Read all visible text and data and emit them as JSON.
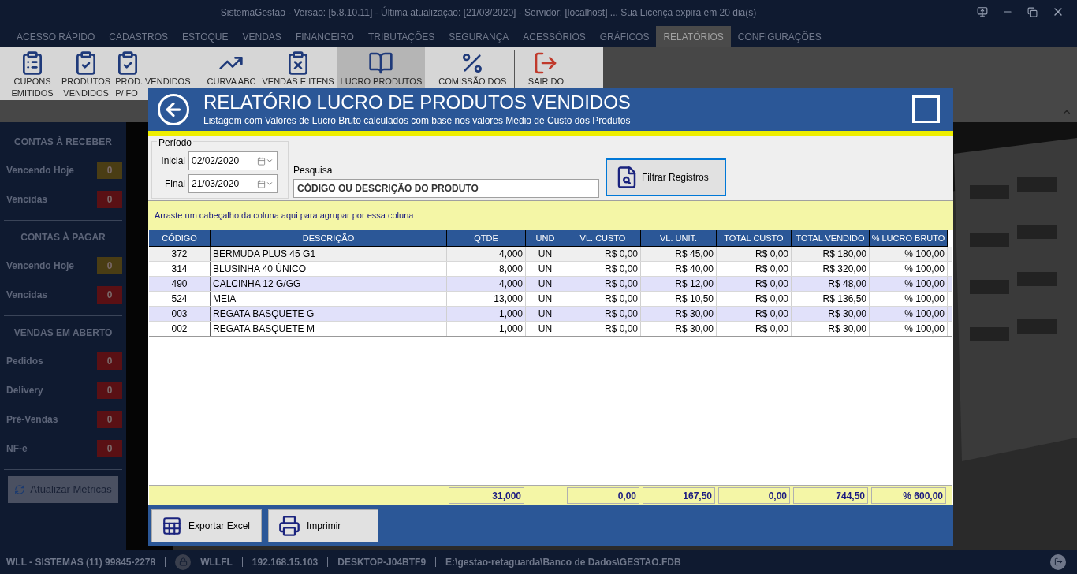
{
  "window": {
    "title": "SistemaGestao - Versão: [5.8.10.11] - Última atualização: [21/03/2020] - Servidor: [localhost] ... Sua Licença expira em 20 dia(s)"
  },
  "tabs": [
    {
      "label": "ACESSO RÁPIDO",
      "selected": false
    },
    {
      "label": "CADASTROS",
      "selected": false
    },
    {
      "label": "ESTOQUE",
      "selected": false
    },
    {
      "label": "VENDAS",
      "selected": false
    },
    {
      "label": "FINANCEIRO",
      "selected": false
    },
    {
      "label": "TRIBUTAÇÕES",
      "selected": false
    },
    {
      "label": "SEGURANÇA",
      "selected": false
    },
    {
      "label": "ACESSÓRIOS",
      "selected": false
    },
    {
      "label": "GRÁFICOS",
      "selected": false
    },
    {
      "label": "RELATÓRIOS",
      "selected": true
    },
    {
      "label": "CONFIGURAÇÕES",
      "selected": false
    }
  ],
  "ribbon": [
    {
      "kind": "coupons",
      "lines": [
        "CUPONS",
        "EMITIDOS"
      ],
      "selected": false
    },
    {
      "kind": "products",
      "lines": [
        "PRODUTOS",
        "VENDIDOS"
      ],
      "selected": false
    },
    {
      "kind": "products",
      "lines": [
        "PROD. VENDIDOS",
        "P/ FO"
      ],
      "selected": false
    },
    {
      "kind": "chart",
      "lines": [
        "CURVA ABC"
      ],
      "selected": false
    },
    {
      "kind": "list",
      "lines": [
        "VENDAS E ITENS"
      ],
      "selected": false
    },
    {
      "kind": "book",
      "lines": [
        "LUCRO PRODUTOS"
      ],
      "selected": true
    },
    {
      "kind": "percent",
      "lines": [
        "COMISSÃO DOS"
      ],
      "selected": false
    },
    {
      "kind": "exit",
      "lines": [
        "SAIR DO"
      ],
      "selected": false
    }
  ],
  "sidebar": {
    "sections": [
      {
        "title": "CONTAS À RECEBER",
        "items": [
          {
            "label": "Vencendo Hoje",
            "count": "0",
            "color": "#4a3d14"
          },
          {
            "label": "Vencidas",
            "count": "0",
            "color": "#5a1014"
          }
        ]
      },
      {
        "title": "CONTAS À PAGAR",
        "items": [
          {
            "label": "Vencendo Hoje",
            "count": "0",
            "color": "#4a3d14"
          },
          {
            "label": "Vencidas",
            "count": "0",
            "color": "#5a1014"
          }
        ]
      },
      {
        "title": "VENDAS EM ABERTO",
        "items": [
          {
            "label": "Pedidos",
            "count": "0",
            "color": "#5a1014"
          },
          {
            "label": "Delivery",
            "count": "0",
            "color": "#5a1014"
          },
          {
            "label": "Pré-Vendas",
            "count": "0",
            "color": "#5a1014"
          },
          {
            "label": "NF-e",
            "count": "0",
            "color": "#5a1014"
          }
        ]
      }
    ],
    "button": "Atualizar Métricas"
  },
  "dialog": {
    "title": "RELATÓRIO LUCRO DE PRODUTOS VENDIDOS",
    "subtitle": "Listagem com Valores de Lucro Bruto calculados com base nos valores Médio de Custo dos Produtos",
    "period": {
      "legend": "Período",
      "start_label": "Inicial",
      "start": "02/02/2020",
      "end_label": "Final",
      "end": "21/03/2020"
    },
    "search": {
      "label": "Pesquisa",
      "value": "CÓDIGO OU DESCRIÇÃO DO PRODUTO"
    },
    "filter_button": "Filtrar Registros",
    "group_hint": "Arraste um cabeçalho da coluna aqui para agrupar por essa coluna",
    "table": {
      "columns": [
        {
          "label": "CÓDIGO"
        },
        {
          "label": "DESCRIÇÃO"
        },
        {
          "label": "QTDE"
        },
        {
          "label": "UND"
        },
        {
          "label": "VL. CUSTO"
        },
        {
          "label": "VL. UNIT."
        },
        {
          "label": "TOTAL CUSTO"
        },
        {
          "label": "TOTAL VENDIDO"
        },
        {
          "label": "% LUCRO BRUTO"
        }
      ],
      "rows": [
        {
          "selected": true,
          "cells": [
            "372",
            "BERMUDA PLUS 45 G1",
            "4,000",
            "UN",
            "R$ 0,00",
            "R$ 45,00",
            "R$ 0,00",
            "R$ 180,00",
            "% 100,00"
          ]
        },
        {
          "selected": false,
          "cells": [
            "314",
            "BLUSINHA 40 ÚNICO",
            "8,000",
            "UN",
            "R$ 0,00",
            "R$ 40,00",
            "R$ 0,00",
            "R$ 320,00",
            "% 100,00"
          ]
        },
        {
          "selected": false,
          "cells": [
            "490",
            "CALCINHA 12 G/GG",
            "4,000",
            "UN",
            "R$ 0,00",
            "R$ 12,00",
            "R$ 0,00",
            "R$ 48,00",
            "% 100,00"
          ]
        },
        {
          "selected": false,
          "cells": [
            "524",
            "MEIA",
            "13,000",
            "UN",
            "R$ 0,00",
            "R$ 10,50",
            "R$ 0,00",
            "R$ 136,50",
            "% 100,00"
          ]
        },
        {
          "selected": false,
          "cells": [
            "003",
            "REGATA BASQUETE G",
            "1,000",
            "UN",
            "R$ 0,00",
            "R$ 30,00",
            "R$ 0,00",
            "R$ 30,00",
            "% 100,00"
          ]
        },
        {
          "selected": false,
          "cells": [
            "002",
            "REGATA BASQUETE M",
            "1,000",
            "UN",
            "R$ 0,00",
            "R$ 30,00",
            "R$ 0,00",
            "R$ 30,00",
            "% 100,00"
          ]
        }
      ]
    },
    "summary": {
      "qtde": "31,000",
      "vl_custo": "0,00",
      "vl_unit": "167,50",
      "total_custo": "0,00",
      "total_vendido": "744,50",
      "lucro_bruto": "% 600,00"
    },
    "buttons": [
      {
        "kind": "excel",
        "label": "Exportar Excel"
      },
      {
        "kind": "print",
        "label": "Imprimir"
      }
    ]
  },
  "status_bar": {
    "company": "WLL - SISTEMAS (11) 99845-2278",
    "user": "WLLFL",
    "ip": "192.168.15.103",
    "machine": "DESKTOP-J04BTF9",
    "database": "E:\\gestao-retaguarda\\Banco de Dados\\GESTAO.FDB"
  }
}
